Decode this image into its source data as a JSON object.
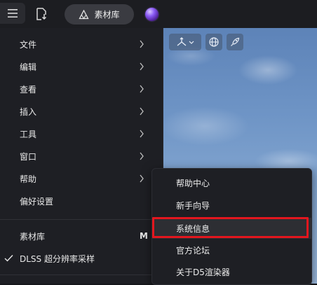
{
  "toolbar": {
    "library_label": "素材库"
  },
  "main_menu": {
    "items": [
      {
        "label": "文件"
      },
      {
        "label": "编辑"
      },
      {
        "label": "查看"
      },
      {
        "label": "插入"
      },
      {
        "label": "工具"
      },
      {
        "label": "窗口"
      },
      {
        "label": "帮助"
      },
      {
        "label": "偏好设置"
      },
      {
        "label": "素材库",
        "shortcut": "M"
      },
      {
        "label": "DLSS 超分辨率采样",
        "checked": true
      }
    ]
  },
  "help_submenu": {
    "items": [
      {
        "label": "帮助中心"
      },
      {
        "label": "新手向导"
      },
      {
        "label": "系统信息"
      },
      {
        "label": "官方论坛"
      },
      {
        "label": "关于D5渲染器"
      }
    ],
    "highlighted": "系统信息"
  },
  "colors": {
    "highlight_border": "#e3161e",
    "menu_bg": "#1e1f24",
    "sky": "#6f95c6"
  }
}
